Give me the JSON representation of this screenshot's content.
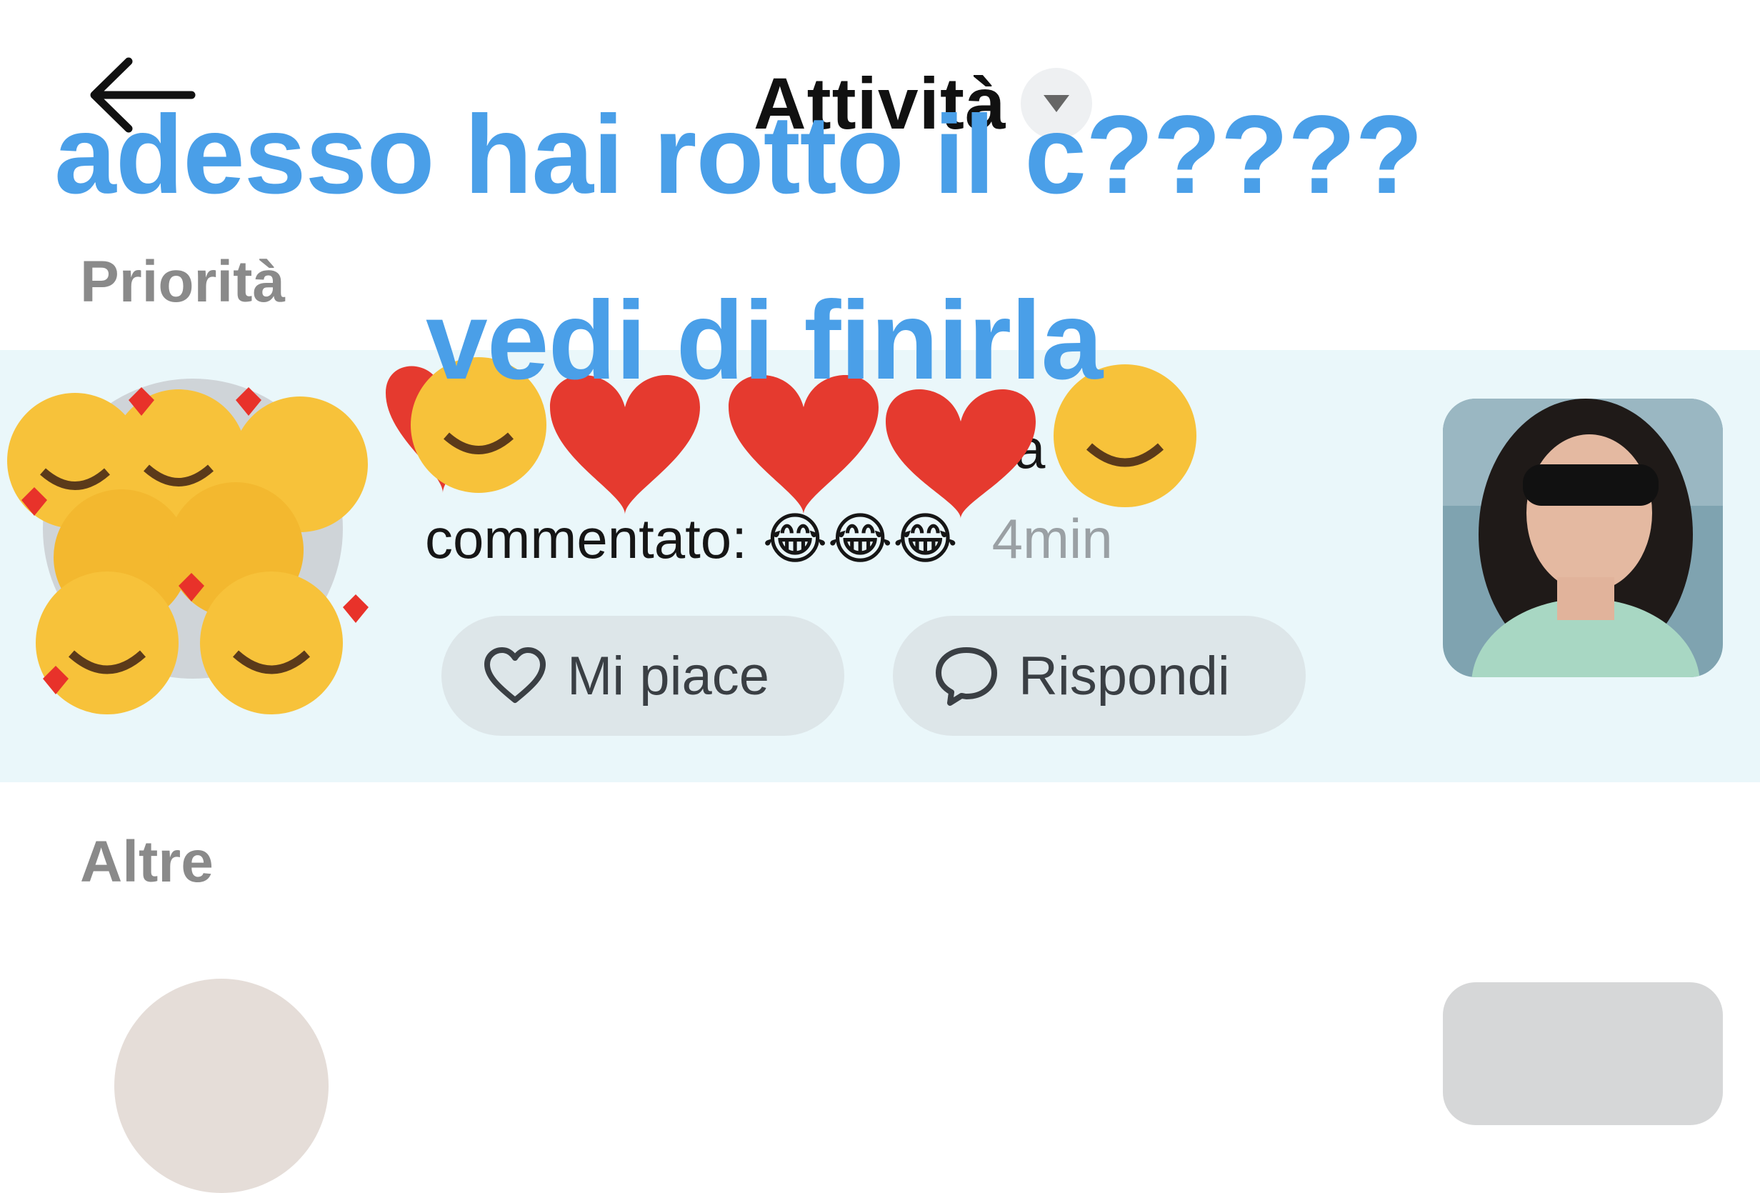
{
  "header": {
    "title": "Attività"
  },
  "sections": {
    "priority_label": "Priorità",
    "other_label": "Altre"
  },
  "notification": {
    "username": "",
    "action": "ha commentato:",
    "comment_emoji": "😂😂😂",
    "time": "4min",
    "like_label": "Mi piace",
    "reply_label": "Rispondi"
  },
  "overlay": {
    "line1": "adesso hai rotto il c?????",
    "line2": "vedi di finirla"
  },
  "colors": {
    "overlay_text": "#4a9fe8",
    "row_highlight": "#eaf7fa",
    "button_bg": "#dde6e9",
    "section_label": "#8a8a8a"
  },
  "icons": [
    "back-arrow-icon",
    "chevron-down-icon",
    "heart-outline-icon",
    "speech-bubble-icon"
  ]
}
